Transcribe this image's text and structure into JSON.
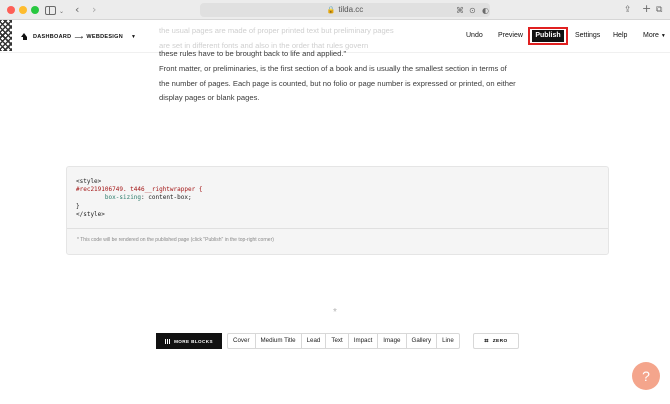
{
  "browser": {
    "url": "tilda.cc",
    "icons": {
      "back": "chevron-left-icon",
      "forward": "chevron-right-icon",
      "share": "share-icon",
      "new_tab": "plus-icon",
      "tabs": "tab-overview-icon"
    }
  },
  "header": {
    "breadcrumb": [
      "DASHBOARD",
      "WEBDESIGN"
    ],
    "breadcrumb_separator": "⟶",
    "menu": {
      "undo": "Undo",
      "preview": "Preview",
      "publish": "Publish",
      "settings": "Settings",
      "help": "Help",
      "more": "More"
    },
    "publish_highlight_color": "#e02020"
  },
  "content": {
    "faded_lines": [
      "the usual pages are made of proper printed text but preliminary pages",
      "are set in different fonts and also in the order that rules govern"
    ],
    "paragraph_1": "these rules have to be brought back to life and applied.\"",
    "paragraph_2": "Front matter, or preliminaries, is the first section of a book and is usually the smallest section in terms of the number of pages. Each page is counted, but no folio or page number is expressed or printed, on either display pages or blank pages."
  },
  "code_block": {
    "line_1": "<style>",
    "selector": "#rec219106749. t446__rightwrapper {",
    "property": "box-sizing",
    "value": ": content-box;",
    "line_4": "}",
    "line_5": "</style>",
    "note": "* This code will be rendered on the published page (click \"Publish\" in the top-right corner)"
  },
  "divider_glyph": "*",
  "toolbar": {
    "more_blocks": "MORE BLOCKS",
    "categories": [
      "Cover",
      "Medium Title",
      "Lead",
      "Text",
      "Impact",
      "Image",
      "Gallery",
      "Line"
    ],
    "zero": "ZERO"
  },
  "help_fab": "?",
  "colors": {
    "accent": "#111111",
    "help_fab": "#f4a58c"
  }
}
